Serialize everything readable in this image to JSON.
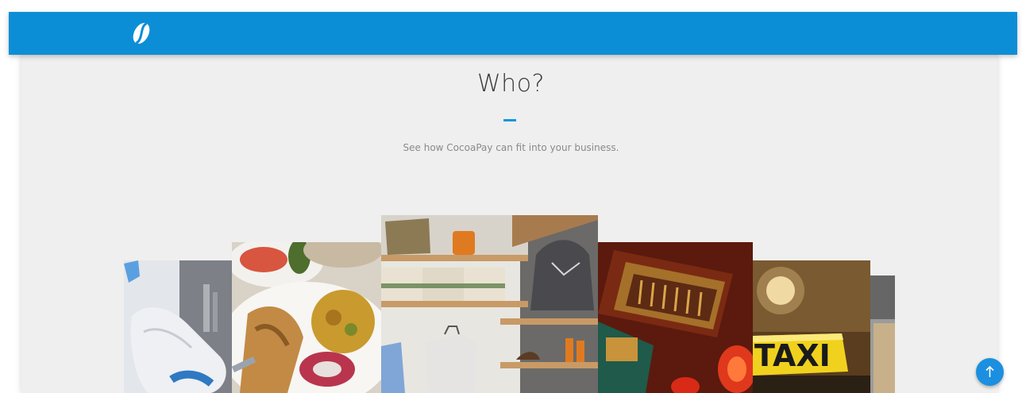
{
  "header": {
    "logo_icon": "coffee-bean-logo-icon",
    "brand_color": "#0c8ed6"
  },
  "section": {
    "title": "Who?",
    "subtitle": "See how CocoaPay can fit into your business.",
    "accent_color": "#1296dd"
  },
  "gallery": {
    "tiles": [
      {
        "id": "healthcare",
        "depicts": "gloved hand"
      },
      {
        "id": "restaurant",
        "depicts": "plated food"
      },
      {
        "id": "retail",
        "depicts": "clothing store shelves"
      },
      {
        "id": "asian-restaurant",
        "depicts": "red lanterns and carved sign"
      },
      {
        "id": "taxi",
        "depicts": "taxi roof sign",
        "sign_text": "TAXI"
      },
      {
        "id": "misc",
        "depicts": "partially visible image"
      }
    ]
  },
  "back_to_top": {
    "icon": "arrow-up-icon",
    "color": "#1c8fe0"
  }
}
